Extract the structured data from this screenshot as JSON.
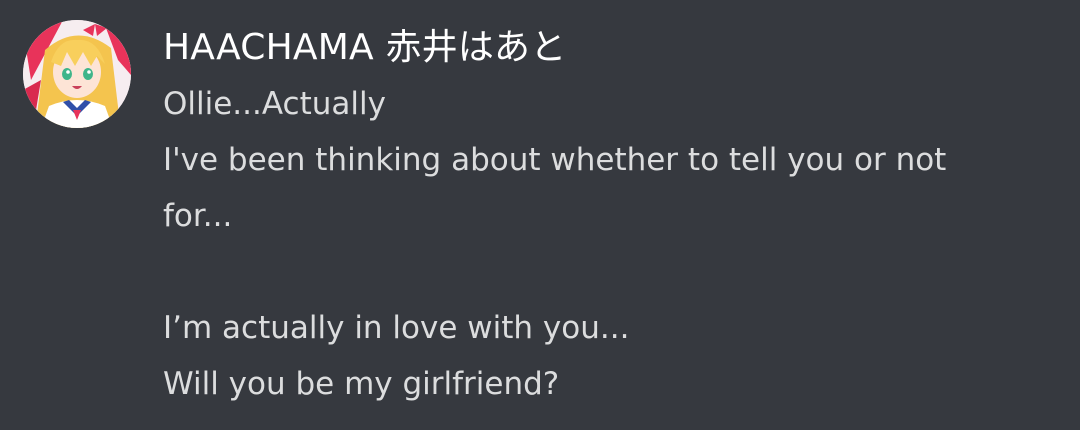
{
  "message": {
    "author": {
      "username": "HAACHAMA 赤井はあと",
      "avatar_icon": "user-avatar-icon"
    },
    "lines": [
      "Ollie...Actually",
      "I've been thinking about whether to tell you or not",
      "for...",
      "",
      "I’m actually in love with you...",
      "Will you be my girlfriend?"
    ]
  },
  "colors": {
    "background": "#36393f",
    "username": "#ffffff",
    "text": "#dcddde"
  }
}
